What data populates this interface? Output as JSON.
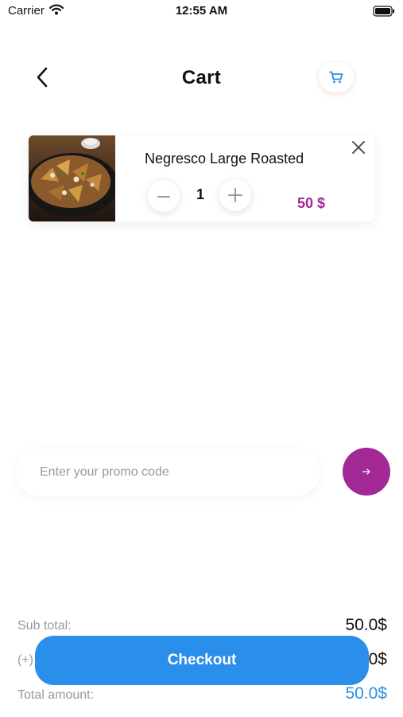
{
  "status_bar": {
    "carrier": "Carrier",
    "time": "12:55 AM"
  },
  "header": {
    "title": "Cart"
  },
  "cart_items": [
    {
      "name": "Negresco Large Roasted",
      "quantity": "1",
      "price": "50 $"
    }
  ],
  "promo": {
    "placeholder": "Enter your promo code"
  },
  "totals": {
    "subtotal_label": "Sub total:",
    "subtotal_value": "50.0$",
    "extra_label": "(+)",
    "extra_value": "50.0$",
    "total_label": "Total amount:",
    "total_value": "50.0$"
  },
  "checkout": {
    "label": "Checkout"
  },
  "colors": {
    "accent_purple": "#a12895",
    "accent_blue": "#2a8fea"
  }
}
